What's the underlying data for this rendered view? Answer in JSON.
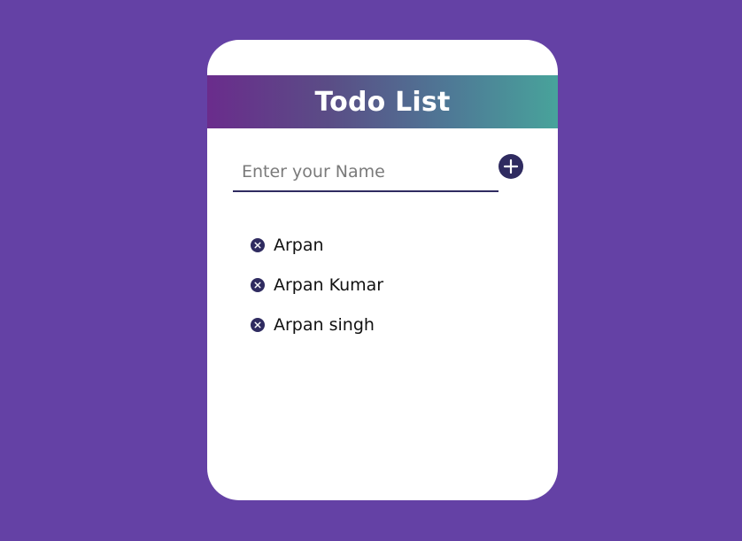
{
  "app": {
    "title": "Todo List"
  },
  "input": {
    "value": "",
    "placeholder": "Enter your Name"
  },
  "add_button": {
    "icon": "plus-icon"
  },
  "todos": [
    {
      "text": "Arpan",
      "icon": "close-icon"
    },
    {
      "text": "Arpan Kumar",
      "icon": "close-icon"
    },
    {
      "text": "Arpan singh",
      "icon": "close-icon"
    }
  ],
  "colors": {
    "background": "#6441a5",
    "card": "#ffffff",
    "accent": "#2f2b60",
    "header_gradient_start": "#6a2c8c",
    "header_gradient_end": "#48a39b"
  }
}
